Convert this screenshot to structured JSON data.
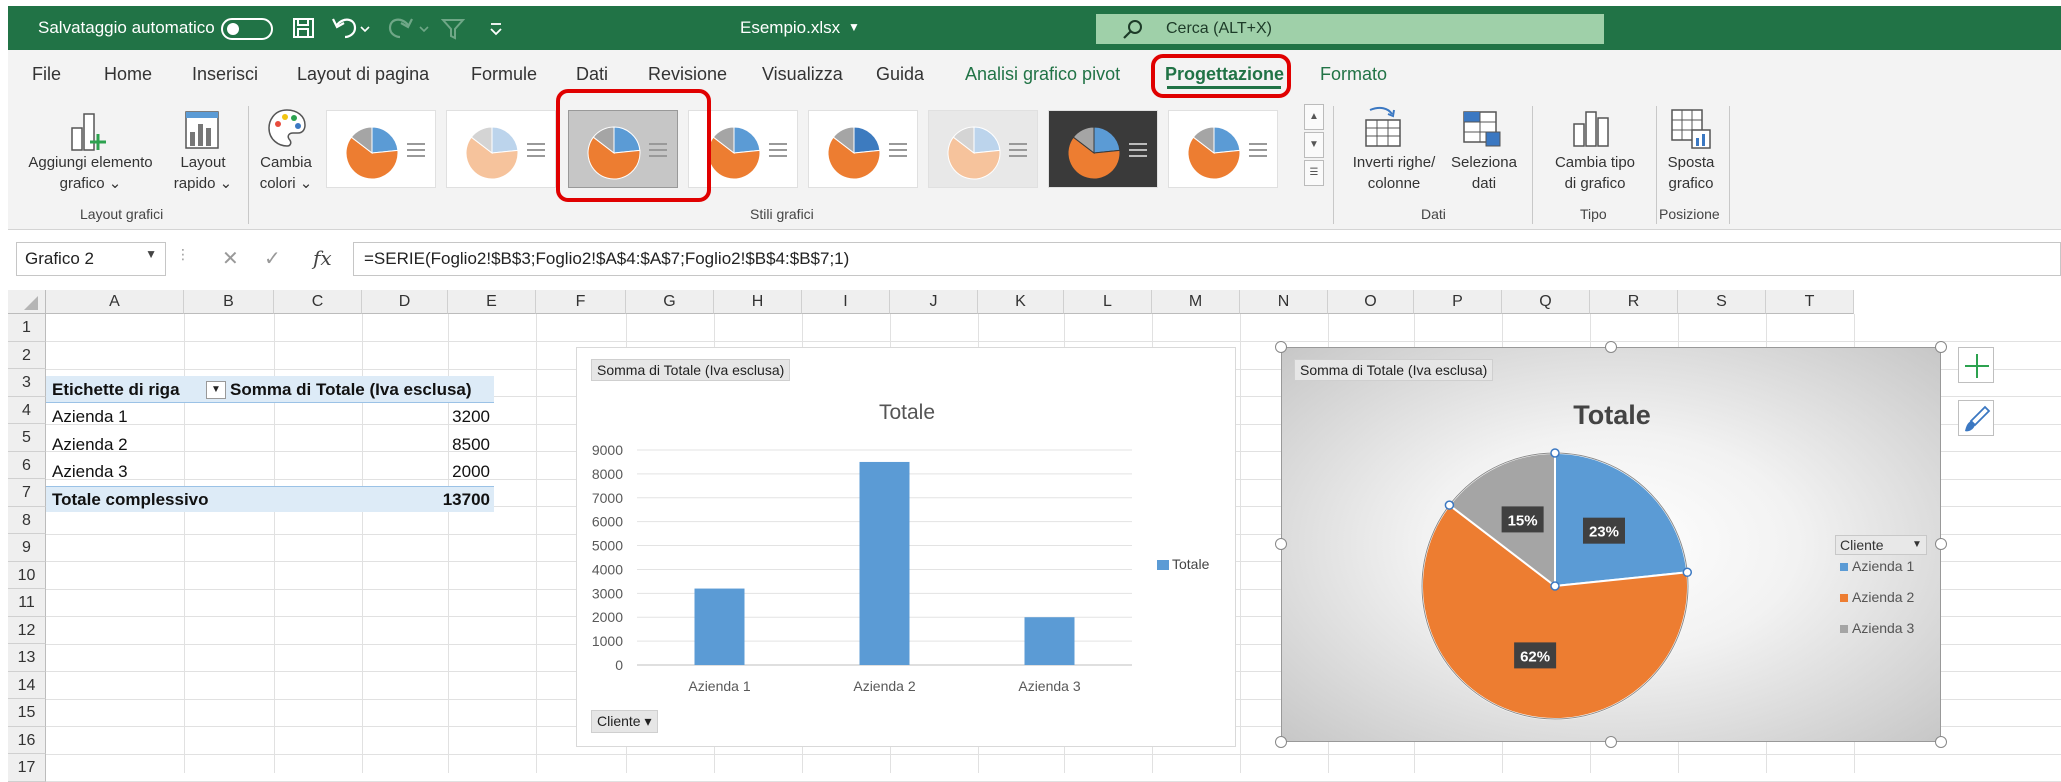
{
  "titlebar": {
    "autosave_label": "Salvataggio automatico",
    "filename": "Esempio.xlsx",
    "search_placeholder": "Cerca (ALT+X)"
  },
  "tabs": [
    "File",
    "Home",
    "Inserisci",
    "Layout di pagina",
    "Formule",
    "Dati",
    "Revisione",
    "Visualizza",
    "Guida",
    "Analisi grafico pivot",
    "Progettazione",
    "Formato"
  ],
  "active_tab": "Progettazione",
  "ribbon": {
    "add_element": [
      "Aggiungi elemento",
      "grafico ⌄"
    ],
    "quick_layout": [
      "Layout",
      "rapido ⌄"
    ],
    "change_colors": [
      "Cambia",
      "colori ⌄"
    ],
    "group_layout": "Layout grafici",
    "group_styles": "Stili grafici",
    "switch_rowcol": [
      "Inverti righe/",
      "colonne"
    ],
    "select_data": [
      "Seleziona",
      "dati"
    ],
    "group_data": "Dati",
    "change_type": [
      "Cambia tipo",
      "di grafico"
    ],
    "group_type": "Tipo",
    "move_chart": [
      "Sposta",
      "grafico"
    ],
    "group_position": "Posizione"
  },
  "formula_bar": {
    "name_box": "Grafico 2",
    "cancel_icon": "✕",
    "enter_icon": "✓",
    "fx_label": "fx",
    "formula": "=SERIE(Foglio2!$B$3;Foglio2!$A$4:$A$7;Foglio2!$B$4:$B$7;1)"
  },
  "grid": {
    "columns": [
      "A",
      "B",
      "C",
      "D",
      "E",
      "F",
      "G",
      "H",
      "I",
      "J",
      "K",
      "L",
      "M",
      "N",
      "O",
      "P",
      "Q",
      "R",
      "S",
      "T"
    ],
    "rows": [
      "1",
      "2",
      "3",
      "4",
      "5",
      "6",
      "7",
      "8",
      "9",
      "10",
      "11",
      "12",
      "13",
      "14",
      "15",
      "16",
      "17"
    ]
  },
  "pivot_table": {
    "header_row_label": "Etichette di riga",
    "header_value": "Somma di Totale (Iva esclusa)",
    "rows": [
      {
        "label": "Azienda 1",
        "value": "3200"
      },
      {
        "label": "Azienda 2",
        "value": "8500"
      },
      {
        "label": "Azienda 3",
        "value": "2000"
      }
    ],
    "total_label": "Totale complessivo",
    "total_value": "13700"
  },
  "chart_data": [
    {
      "type": "bar",
      "field_button": "Somma di Totale (Iva esclusa)",
      "title": "Totale",
      "categories": [
        "Azienda 1",
        "Azienda 2",
        "Azienda 3"
      ],
      "series": [
        {
          "name": "Totale",
          "values": [
            3200,
            8500,
            2000
          ]
        }
      ],
      "ylim": [
        0,
        9000
      ],
      "yticks": [
        "0",
        "1000",
        "2000",
        "3000",
        "4000",
        "5000",
        "6000",
        "7000",
        "8000",
        "9000"
      ],
      "grid": true,
      "legend_position": "right",
      "axis_field_button": "Cliente ▾"
    },
    {
      "type": "pie",
      "field_button": "Somma di Totale (Iva esclusa)",
      "title": "Totale",
      "categories": [
        "Azienda 1",
        "Azienda 2",
        "Azienda 3"
      ],
      "values": [
        3200,
        8500,
        2000
      ],
      "labels": [
        "23%",
        "62%",
        "15%"
      ],
      "colors": [
        "#5b9bd5",
        "#ed7d31",
        "#a5a5a5"
      ],
      "legend_title": "Cliente",
      "legend_position": "right"
    }
  ]
}
